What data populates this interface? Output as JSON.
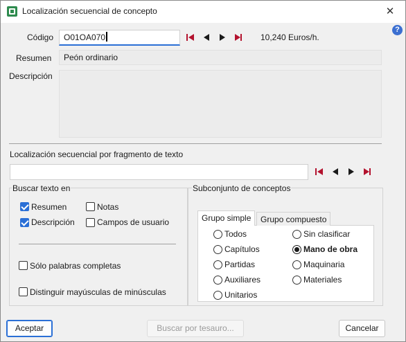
{
  "window": {
    "title": "Localización secuencial de concepto",
    "close_glyph": "✕",
    "help_glyph": "?"
  },
  "codigo": {
    "label": "Código",
    "value": "O01OA070",
    "price": "10,240 Euros/h."
  },
  "resumen": {
    "label": "Resumen",
    "value": "Peón ordinario"
  },
  "descripcion": {
    "label": "Descripción",
    "value": ""
  },
  "localizacion": {
    "label": "Localización secuencial por fragmento de texto",
    "value": ""
  },
  "buscar": {
    "title": "Buscar texto en",
    "options": [
      {
        "label": "Resumen",
        "checked": true
      },
      {
        "label": "Notas",
        "checked": false
      },
      {
        "label": "Descripción",
        "checked": true
      },
      {
        "label": "Campos de usuario",
        "checked": false
      }
    ],
    "solo_palabras": {
      "label": "Sólo palabras completas",
      "checked": false
    },
    "distinguir": {
      "label": "Distinguir mayúsculas de minúsculas",
      "checked": false
    }
  },
  "subconjunto": {
    "title": "Subconjunto de conceptos",
    "tabs": [
      {
        "label": "Grupo simple",
        "active": true
      },
      {
        "label": "Grupo compuesto",
        "active": false
      }
    ],
    "radios": [
      {
        "label": "Todos",
        "checked": false
      },
      {
        "label": "Sin clasificar",
        "checked": false
      },
      {
        "label": "Capítulos",
        "checked": false
      },
      {
        "label": "Mano de obra",
        "checked": true
      },
      {
        "label": "Partidas",
        "checked": false
      },
      {
        "label": "Maquinaria",
        "checked": false
      },
      {
        "label": "Auxiliares",
        "checked": false
      },
      {
        "label": "Materiales",
        "checked": false
      },
      {
        "label": "Unitarios",
        "checked": false
      }
    ]
  },
  "buttons": {
    "aceptar": "Aceptar",
    "tesauro": "Buscar por tesauro...",
    "cancelar": "Cancelar"
  },
  "colors": {
    "accent": "#2a6fd6",
    "nav_red": "#b3122e"
  }
}
